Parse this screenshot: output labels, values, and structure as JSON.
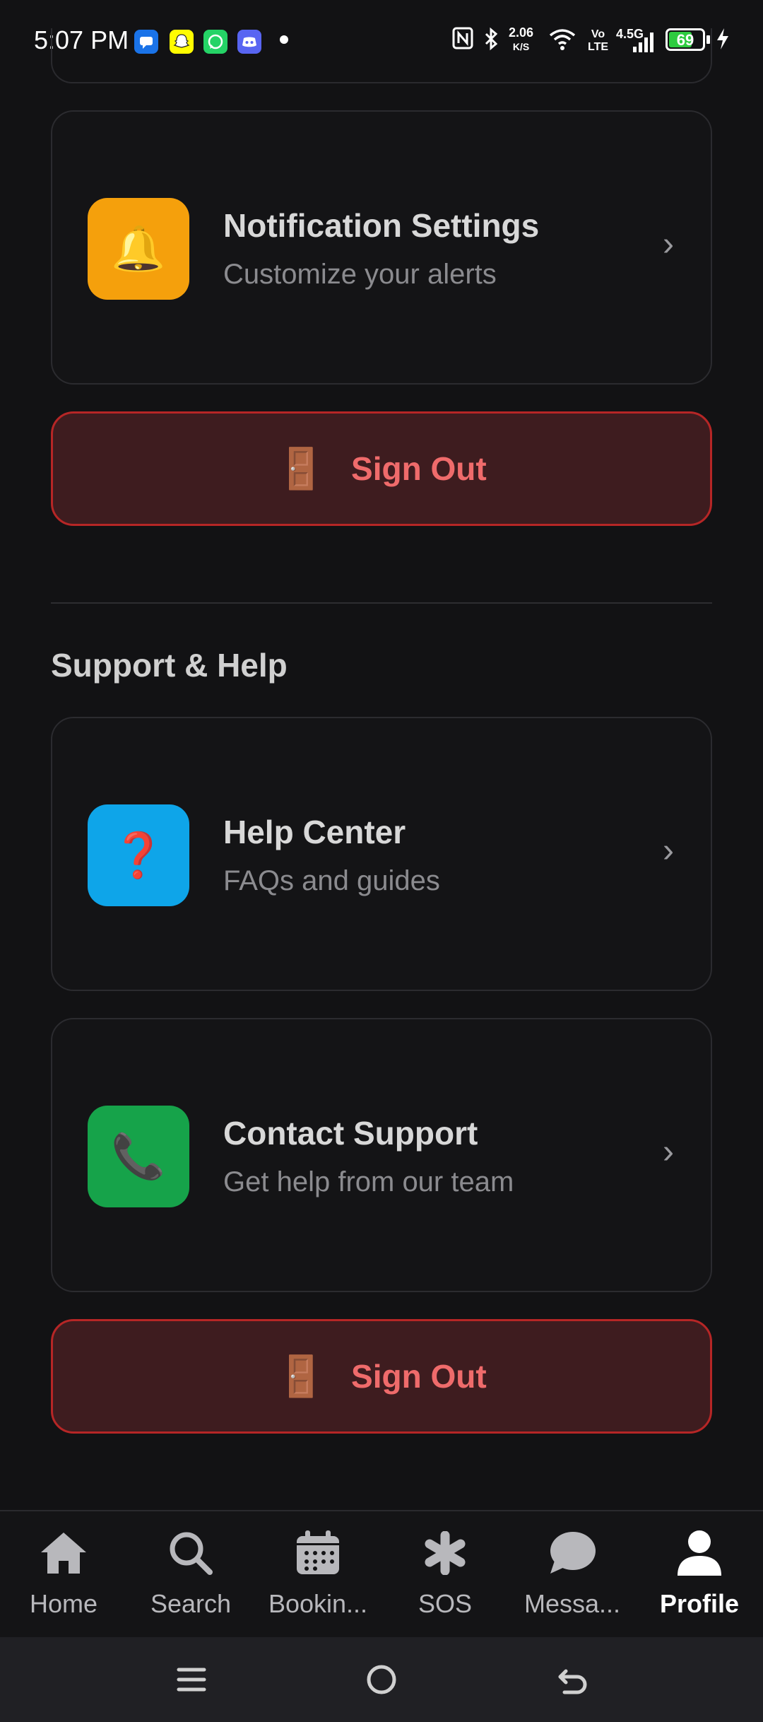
{
  "status_bar": {
    "time": "5:07 PM",
    "app_icons": [
      "messenger-icon",
      "snapchat-icon",
      "whatsapp-icon",
      "discord-icon"
    ],
    "speed_value": "2.06",
    "speed_unit": "K/S",
    "volte_top": "Vo",
    "volte_bottom": "LTE",
    "network": "4.5G",
    "battery_level": "69",
    "battery_percent": 69
  },
  "notification_card": {
    "title": "Notification Settings",
    "subtitle": "Customize your alerts",
    "icon": "bell-icon",
    "icon_glyph": "🔔",
    "chevron": "›",
    "tile_color": "#f5a00c"
  },
  "sign_out_1": {
    "label": "Sign Out",
    "icon_glyph": "🚪"
  },
  "support": {
    "section_title": "Support & Help",
    "items": [
      {
        "title": "Help Center",
        "subtitle": "FAQs and guides",
        "icon": "question-icon",
        "icon_glyph": "❓",
        "chevron": "›",
        "tile_color": "#0ea5e9"
      },
      {
        "title": "Contact Support",
        "subtitle": "Get help from our team",
        "icon": "phone-icon",
        "icon_glyph": "📞",
        "chevron": "›",
        "tile_color": "#16a34a"
      }
    ]
  },
  "sign_out_2": {
    "label": "Sign Out",
    "icon_glyph": "🚪"
  },
  "bottom_nav": {
    "items": [
      {
        "label": "Home",
        "icon": "home-icon"
      },
      {
        "label": "Search",
        "icon": "search-icon"
      },
      {
        "label": "Bookin...",
        "icon": "calendar-icon"
      },
      {
        "label": "SOS",
        "icon": "asterisk-icon"
      },
      {
        "label": "Messa...",
        "icon": "chat-bubble-icon"
      },
      {
        "label": "Profile",
        "icon": "user-icon",
        "active": true
      }
    ]
  },
  "colors": {
    "background": "#121214",
    "sign_out_border": "#b62626",
    "sign_out_text": "#ef6b6b",
    "sign_out_bg": "#3e1c1f"
  }
}
